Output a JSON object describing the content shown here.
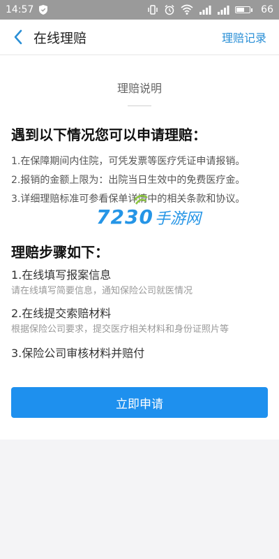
{
  "status_bar": {
    "time": "14:57",
    "battery_level": 0.66,
    "battery_text": "66",
    "icons": [
      "shield-icon",
      "vibrate-icon",
      "alarm-icon",
      "wifi-icon",
      "signal-icon",
      "battery-icon"
    ]
  },
  "nav": {
    "title": "在线理赔",
    "right_link": "理赔记录",
    "accent": "#2a8fd6"
  },
  "intro": {
    "title": "理赔说明",
    "heading": "遇到以下情况您可以申请理赔：",
    "items": [
      "1.在保障期间内住院，可凭发票等医疗凭证申请报销。",
      "2.报销的金额上限为：出院当日生效中的免费医疗金。",
      "3.详细理赔标准可参看保单详情中的相关条款和协议。"
    ]
  },
  "watermark": {
    "number": "7230",
    "text": "手游网"
  },
  "steps": {
    "heading": "理赔步骤如下：",
    "items": [
      {
        "title": "1.在线填写报案信息",
        "desc": "请在线填写简要信息，通知保险公司就医情况"
      },
      {
        "title": "2.在线提交索赔材料",
        "desc": "根据保险公司要求，提交医疗相关材料和身份证照片等"
      },
      {
        "title": "3.保险公司审核材料并赔付",
        "desc": ""
      }
    ]
  },
  "apply_button": {
    "label": "立即申请",
    "color": "#1e90ee"
  }
}
